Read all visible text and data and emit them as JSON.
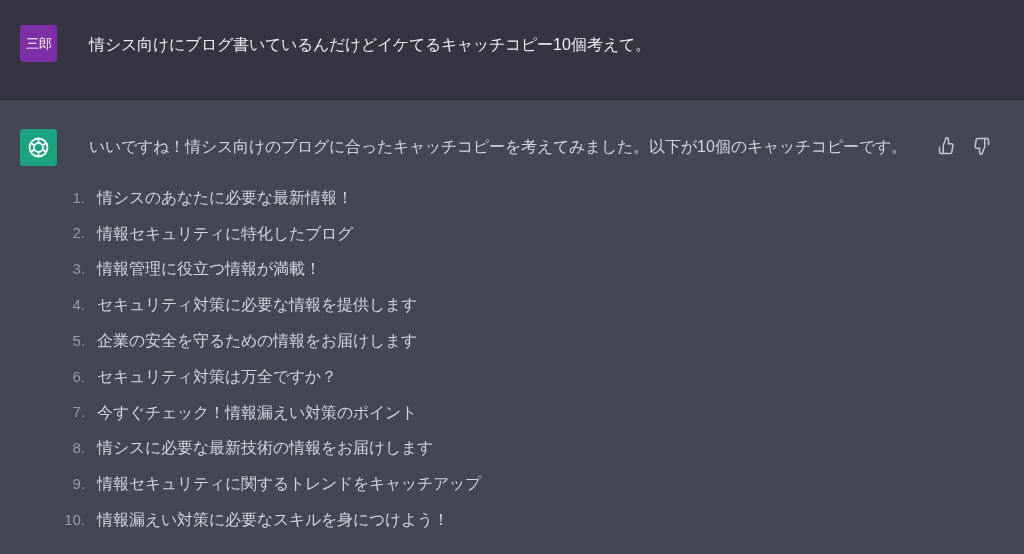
{
  "user_message": {
    "avatar_text": "三郎",
    "text": "情シス向けにブログ書いているんだけどイケてるキャッチコピー10個考えて。"
  },
  "assistant_message": {
    "intro": "いいですね！情シス向けのブログに合ったキャッチコピーを考えてみました。以下が10個のキャッチコピーです。",
    "items": [
      {
        "number": "1.",
        "text": "情シスのあなたに必要な最新情報！"
      },
      {
        "number": "2.",
        "text": "情報セキュリティに特化したブログ"
      },
      {
        "number": "3.",
        "text": "情報管理に役立つ情報が満載！"
      },
      {
        "number": "4.",
        "text": "セキュリティ対策に必要な情報を提供します"
      },
      {
        "number": "5.",
        "text": "企業の安全を守るための情報をお届けします"
      },
      {
        "number": "6.",
        "text": "セキュリティ対策は万全ですか？"
      },
      {
        "number": "7.",
        "text": "今すぐチェック！情報漏えい対策のポイント"
      },
      {
        "number": "8.",
        "text": "情シスに必要な最新技術の情報をお届けします"
      },
      {
        "number": "9.",
        "text": "情報セキュリティに関するトレンドをキャッチアップ"
      },
      {
        "number": "10.",
        "text": "情報漏えい対策に必要なスキルを身につけよう！"
      }
    ]
  }
}
